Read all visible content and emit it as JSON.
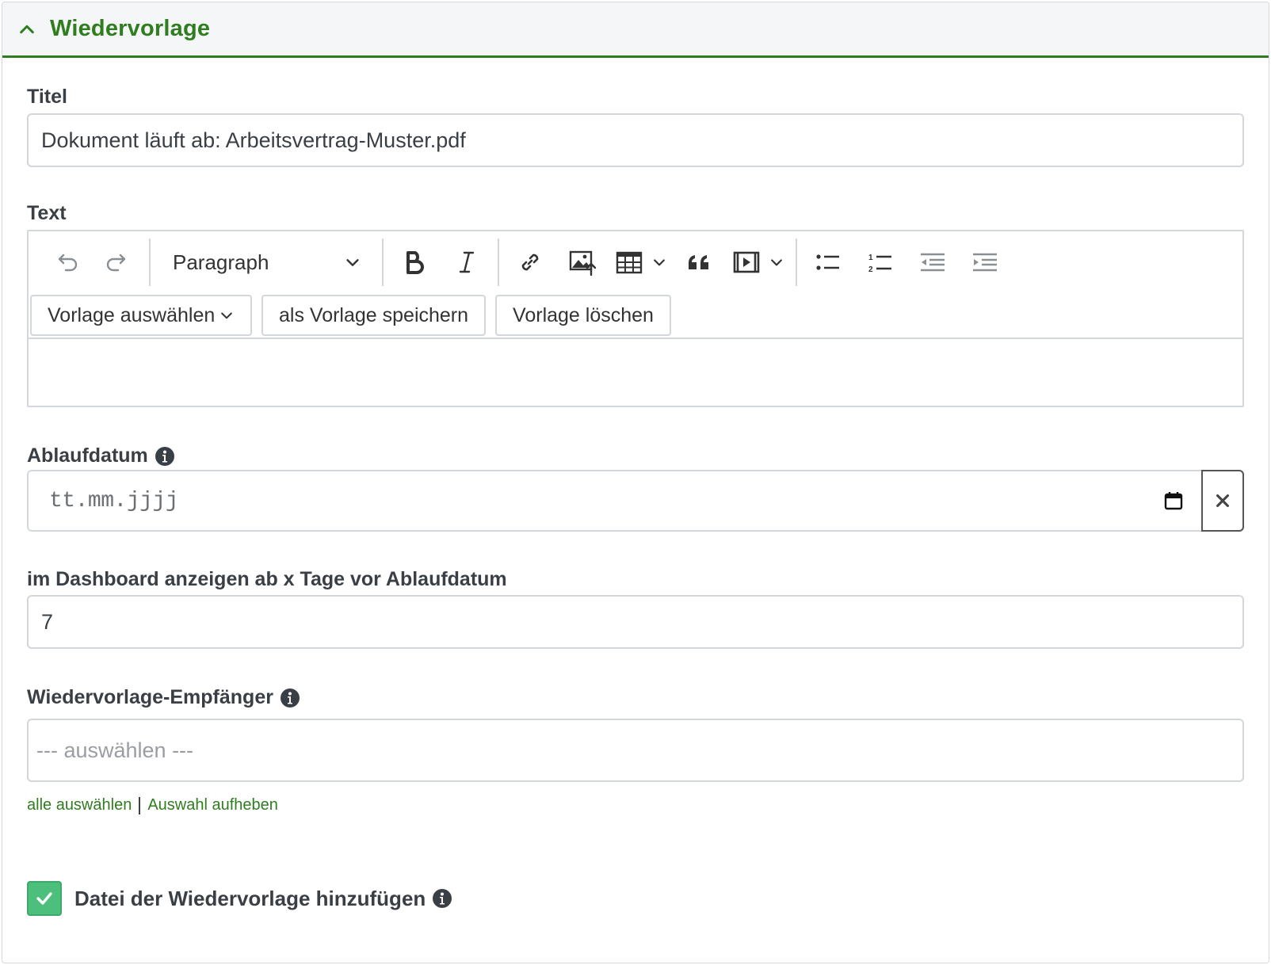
{
  "section": {
    "title": "Wiedervorlage"
  },
  "fields": {
    "titel": {
      "label": "Titel",
      "value": "Dokument läuft ab: Arbeitsvertrag-Muster.pdf"
    },
    "text": {
      "label": "Text",
      "toolbar": {
        "heading_select": "Paragraph",
        "template_select": "Vorlage auswählen",
        "save_template": "als Vorlage speichern",
        "delete_template": "Vorlage löschen"
      }
    },
    "ablaufdatum": {
      "label": "Ablaufdatum",
      "placeholder": "tt.mm.jjjj"
    },
    "dashboard_days": {
      "label": "im Dashboard anzeigen ab x Tage vor Ablaufdatum",
      "value": "7"
    },
    "empfaenger": {
      "label": "Wiedervorlage-Empfänger",
      "placeholder": "--- auswählen ---",
      "select_all": "alle auswählen",
      "clear_selection": "Auswahl aufheben"
    },
    "attach_file": {
      "label": "Datei der Wiedervorlage hinzufügen",
      "checked": true
    }
  },
  "colors": {
    "accent": "#2f7d1f",
    "checkbox": "#4cbf7d",
    "border": "#d3d7dc",
    "text": "#3a3f45"
  }
}
